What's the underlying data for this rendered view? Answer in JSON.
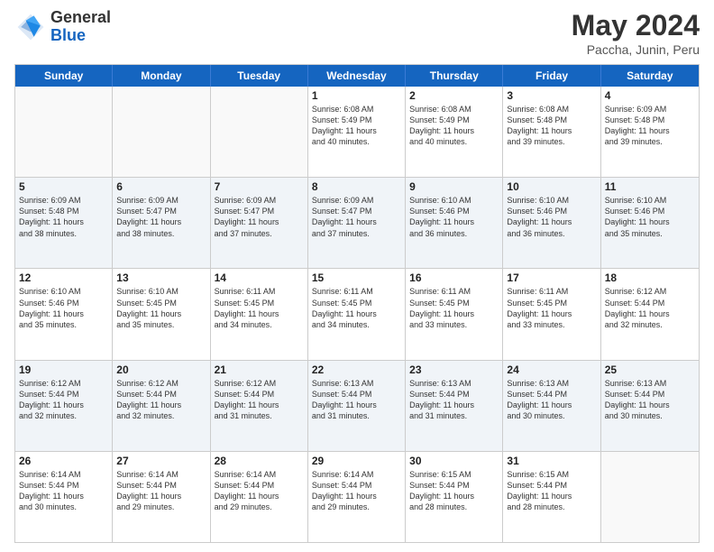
{
  "header": {
    "logo_general": "General",
    "logo_blue": "Blue",
    "month_title": "May 2024",
    "subtitle": "Paccha, Junin, Peru"
  },
  "days_of_week": [
    "Sunday",
    "Monday",
    "Tuesday",
    "Wednesday",
    "Thursday",
    "Friday",
    "Saturday"
  ],
  "weeks": [
    [
      {
        "day": "",
        "info": ""
      },
      {
        "day": "",
        "info": ""
      },
      {
        "day": "",
        "info": ""
      },
      {
        "day": "1",
        "info": "Sunrise: 6:08 AM\nSunset: 5:49 PM\nDaylight: 11 hours\nand 40 minutes."
      },
      {
        "day": "2",
        "info": "Sunrise: 6:08 AM\nSunset: 5:49 PM\nDaylight: 11 hours\nand 40 minutes."
      },
      {
        "day": "3",
        "info": "Sunrise: 6:08 AM\nSunset: 5:48 PM\nDaylight: 11 hours\nand 39 minutes."
      },
      {
        "day": "4",
        "info": "Sunrise: 6:09 AM\nSunset: 5:48 PM\nDaylight: 11 hours\nand 39 minutes."
      }
    ],
    [
      {
        "day": "5",
        "info": "Sunrise: 6:09 AM\nSunset: 5:48 PM\nDaylight: 11 hours\nand 38 minutes."
      },
      {
        "day": "6",
        "info": "Sunrise: 6:09 AM\nSunset: 5:47 PM\nDaylight: 11 hours\nand 38 minutes."
      },
      {
        "day": "7",
        "info": "Sunrise: 6:09 AM\nSunset: 5:47 PM\nDaylight: 11 hours\nand 37 minutes."
      },
      {
        "day": "8",
        "info": "Sunrise: 6:09 AM\nSunset: 5:47 PM\nDaylight: 11 hours\nand 37 minutes."
      },
      {
        "day": "9",
        "info": "Sunrise: 6:10 AM\nSunset: 5:46 PM\nDaylight: 11 hours\nand 36 minutes."
      },
      {
        "day": "10",
        "info": "Sunrise: 6:10 AM\nSunset: 5:46 PM\nDaylight: 11 hours\nand 36 minutes."
      },
      {
        "day": "11",
        "info": "Sunrise: 6:10 AM\nSunset: 5:46 PM\nDaylight: 11 hours\nand 35 minutes."
      }
    ],
    [
      {
        "day": "12",
        "info": "Sunrise: 6:10 AM\nSunset: 5:46 PM\nDaylight: 11 hours\nand 35 minutes."
      },
      {
        "day": "13",
        "info": "Sunrise: 6:10 AM\nSunset: 5:45 PM\nDaylight: 11 hours\nand 35 minutes."
      },
      {
        "day": "14",
        "info": "Sunrise: 6:11 AM\nSunset: 5:45 PM\nDaylight: 11 hours\nand 34 minutes."
      },
      {
        "day": "15",
        "info": "Sunrise: 6:11 AM\nSunset: 5:45 PM\nDaylight: 11 hours\nand 34 minutes."
      },
      {
        "day": "16",
        "info": "Sunrise: 6:11 AM\nSunset: 5:45 PM\nDaylight: 11 hours\nand 33 minutes."
      },
      {
        "day": "17",
        "info": "Sunrise: 6:11 AM\nSunset: 5:45 PM\nDaylight: 11 hours\nand 33 minutes."
      },
      {
        "day": "18",
        "info": "Sunrise: 6:12 AM\nSunset: 5:44 PM\nDaylight: 11 hours\nand 32 minutes."
      }
    ],
    [
      {
        "day": "19",
        "info": "Sunrise: 6:12 AM\nSunset: 5:44 PM\nDaylight: 11 hours\nand 32 minutes."
      },
      {
        "day": "20",
        "info": "Sunrise: 6:12 AM\nSunset: 5:44 PM\nDaylight: 11 hours\nand 32 minutes."
      },
      {
        "day": "21",
        "info": "Sunrise: 6:12 AM\nSunset: 5:44 PM\nDaylight: 11 hours\nand 31 minutes."
      },
      {
        "day": "22",
        "info": "Sunrise: 6:13 AM\nSunset: 5:44 PM\nDaylight: 11 hours\nand 31 minutes."
      },
      {
        "day": "23",
        "info": "Sunrise: 6:13 AM\nSunset: 5:44 PM\nDaylight: 11 hours\nand 31 minutes."
      },
      {
        "day": "24",
        "info": "Sunrise: 6:13 AM\nSunset: 5:44 PM\nDaylight: 11 hours\nand 30 minutes."
      },
      {
        "day": "25",
        "info": "Sunrise: 6:13 AM\nSunset: 5:44 PM\nDaylight: 11 hours\nand 30 minutes."
      }
    ],
    [
      {
        "day": "26",
        "info": "Sunrise: 6:14 AM\nSunset: 5:44 PM\nDaylight: 11 hours\nand 30 minutes."
      },
      {
        "day": "27",
        "info": "Sunrise: 6:14 AM\nSunset: 5:44 PM\nDaylight: 11 hours\nand 29 minutes."
      },
      {
        "day": "28",
        "info": "Sunrise: 6:14 AM\nSunset: 5:44 PM\nDaylight: 11 hours\nand 29 minutes."
      },
      {
        "day": "29",
        "info": "Sunrise: 6:14 AM\nSunset: 5:44 PM\nDaylight: 11 hours\nand 29 minutes."
      },
      {
        "day": "30",
        "info": "Sunrise: 6:15 AM\nSunset: 5:44 PM\nDaylight: 11 hours\nand 28 minutes."
      },
      {
        "day": "31",
        "info": "Sunrise: 6:15 AM\nSunset: 5:44 PM\nDaylight: 11 hours\nand 28 minutes."
      },
      {
        "day": "",
        "info": ""
      }
    ]
  ]
}
